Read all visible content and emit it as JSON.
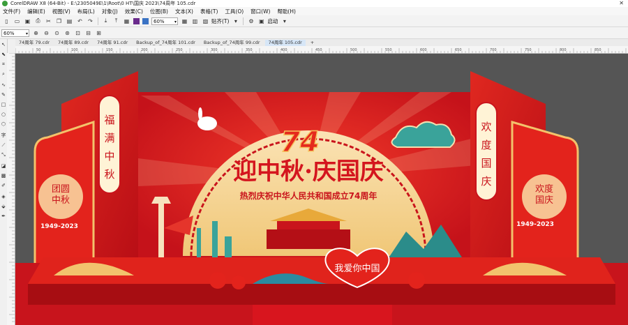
{
  "window": {
    "title": "CorelDRAW X8 (64-Bit) - E:\\2305049E\\1\\Root\\0 HT\\国庆 2023\\74周年 105.cdr",
    "close_glyph": "✕"
  },
  "menu": [
    "文件(F)",
    "编辑(E)",
    "视图(V)",
    "布局(L)",
    "对象(J)",
    "效果(C)",
    "位图(B)",
    "文本(X)",
    "表格(T)",
    "工具(O)",
    "窗口(W)",
    "帮助(H)"
  ],
  "toolbar1": {
    "zoom_value": "60%",
    "snap_label": "贴齐(T)",
    "launch_label": "启动"
  },
  "toolbar2": {
    "zoom_value": "60%"
  },
  "tabs": [
    {
      "label": "74周年 79.cdr",
      "active": false
    },
    {
      "label": "74周年 89.cdr",
      "active": false
    },
    {
      "label": "74周年 91.cdr",
      "active": false
    },
    {
      "label": "Backup_of_74周年 101.cdr",
      "active": false
    },
    {
      "label": "Backup_of_74周年 99.cdr",
      "active": false
    },
    {
      "label": "74周年 105.cdr",
      "active": true
    }
  ],
  "ruler": {
    "h_ticks": [
      "50",
      "100",
      "150",
      "200",
      "250",
      "300",
      "350",
      "400",
      "450",
      "500",
      "550",
      "600",
      "650",
      "700",
      "750",
      "800",
      "850"
    ]
  },
  "design": {
    "main_title": "迎中秋·庆国庆",
    "number": "74",
    "subtitle": "热烈庆祝中华人民共和国成立74周年",
    "left_vertical": "福满中秋",
    "right_vertical": "欢度国庆",
    "left_panel_text": "团圆\n中秋",
    "left_panel_year": "1949-2023",
    "right_panel_text": "欢度\n国庆",
    "right_panel_year": "1949-2023",
    "heart_text": "我爱你中国"
  },
  "colors": {
    "canvas_bg": "#555555",
    "stage_red": "#d8151e",
    "dark_red": "#a70d12",
    "gold": "#f4c56d",
    "cream": "#fbe3b5",
    "teal": "#3aa39a"
  }
}
